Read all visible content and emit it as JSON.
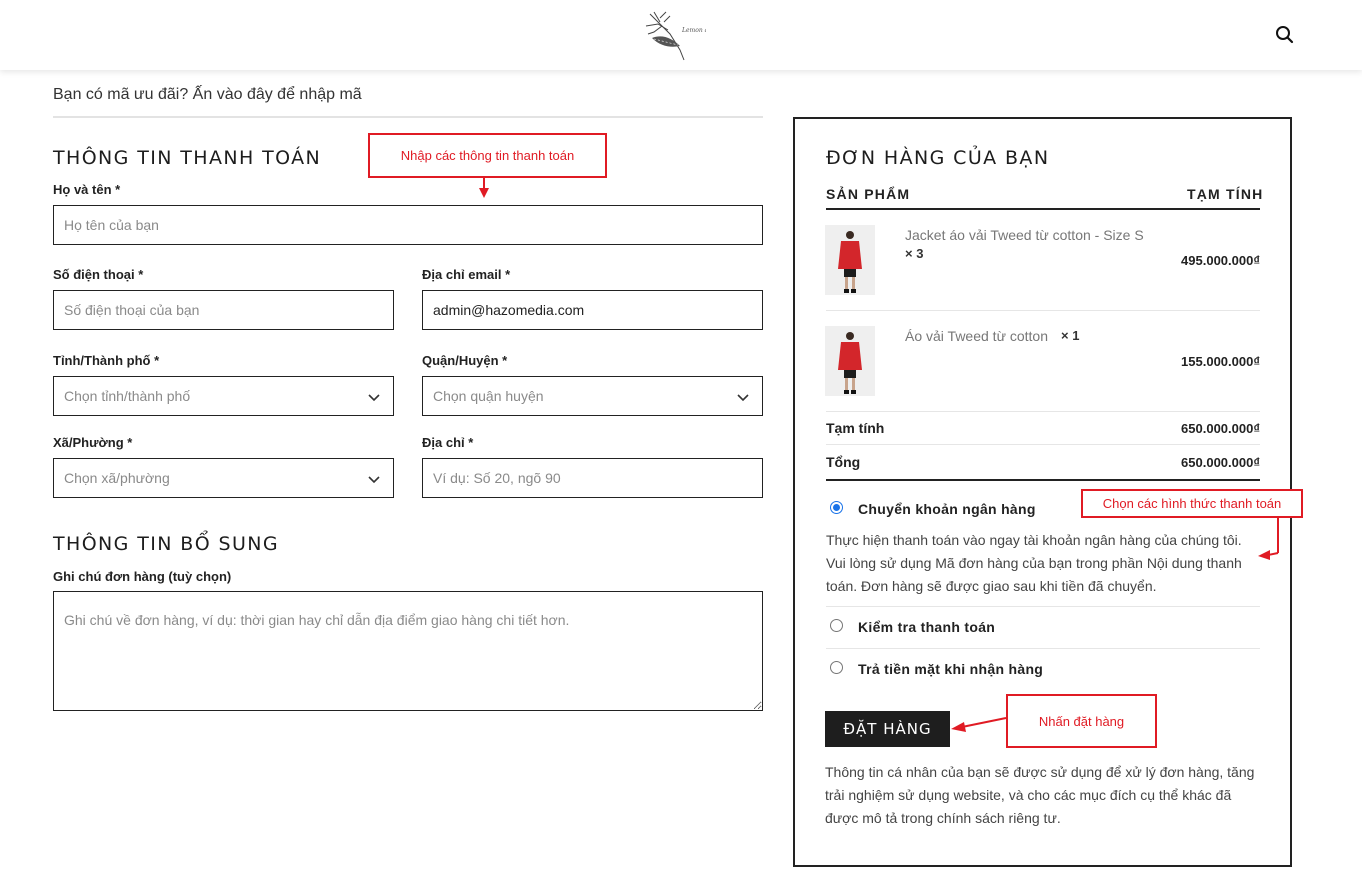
{
  "header": {
    "logo_icon": "flower-logo-icon",
    "search_icon": "search-icon"
  },
  "coupon": {
    "text": "Bạn có mã ưu đãi? Ấn vào đây để nhập mã"
  },
  "billing": {
    "title": "THÔNG TIN THANH TOÁN",
    "name_label": "Họ và tên *",
    "name_placeholder": "Họ tên của bạn",
    "phone_label": "Số điện thoại *",
    "phone_placeholder": "Số điện thoại của bạn",
    "email_label": "Địa chỉ email *",
    "email_value": "admin@hazomedia.com",
    "city_label": "Tỉnh/Thành phố *",
    "city_value": "Chọn tỉnh/thành phố",
    "district_label": "Quận/Huyện *",
    "district_value": "Chọn quận huyện",
    "ward_label": "Xã/Phường *",
    "ward_value": "Chọn xã/phường",
    "address_label": "Địa chỉ *",
    "address_placeholder": "Ví dụ: Số 20, ngõ 90"
  },
  "additional": {
    "title": "THÔNG TIN BỔ SUNG",
    "note_label": "Ghi chú đơn hàng (tuỳ chọn)",
    "note_placeholder": "Ghi chú về đơn hàng, ví dụ: thời gian hay chỉ dẫn địa điểm giao hàng chi tiết hơn."
  },
  "order": {
    "title": "ĐƠN HÀNG CỦA BẠN",
    "col_product": "SẢN PHẨM",
    "col_subtotal": "TẠM TÍNH",
    "items": [
      {
        "name": "Jacket áo vải Tweed từ cotton - Size S",
        "qty": "× 3",
        "price": "495.000.000₫"
      },
      {
        "name": "Áo vải Tweed từ cotton",
        "qty": "× 1",
        "price": "155.000.000₫"
      }
    ],
    "subtotal_label": "Tạm tính",
    "subtotal_value": "650.000.000₫",
    "total_label": "Tổng",
    "total_value": "650.000.000₫"
  },
  "payment": {
    "bank_label": "Chuyển khoản ngân hàng",
    "bank_desc_1": "Thực hiện thanh toán vào ngay tài khoản ngân hàng của chúng tôi.",
    "bank_desc_2": "Vui lòng sử dụng Mã đơn hàng của bạn trong phần Nội dung thanh",
    "bank_desc_3": "toán. Đơn hàng sẽ được giao sau khi tiền đã chuyển.",
    "check_label": "Kiểm tra thanh toán",
    "cod_label": "Trả tiền mặt khi nhận hàng",
    "selected": "bank"
  },
  "place_order": {
    "label": "ĐẶT HÀNG"
  },
  "privacy": {
    "line1": "Thông tin cá nhân của bạn sẽ được sử dụng để xử lý đơn hàng, tăng",
    "line2": "trải nghiệm sử dụng website, và cho các mục đích cụ thể khác đã",
    "line3": "được mô tả trong chính sách riêng tư."
  },
  "annotations": {
    "billing_note": "Nhập các thông tin thanh toán",
    "payment_note": "Chọn các hình thức thanh toán",
    "order_note": "Nhấn đặt hàng",
    "color": "#e01b24"
  }
}
